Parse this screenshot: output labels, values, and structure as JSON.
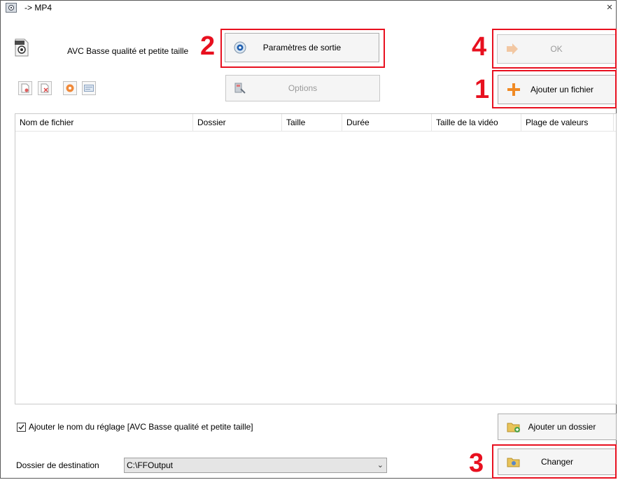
{
  "window": {
    "title": "-> MP4",
    "close_symbol": "×"
  },
  "preset": {
    "label": "AVC Basse qualité et petite taille"
  },
  "buttons": {
    "output_params": "Paramètres de sortie",
    "ok": "OK",
    "options": "Options",
    "add_file": "Ajouter un fichier",
    "add_folder": "Ajouter un dossier",
    "change": "Changer"
  },
  "annotations": {
    "n1": "1",
    "n2": "2",
    "n3": "3",
    "n4": "4",
    "color": "#e8101f"
  },
  "table": {
    "columns": [
      "Nom de fichier",
      "Dossier",
      "Taille",
      "Durée",
      "Taille de la vidéo",
      "Plage de valeurs"
    ]
  },
  "options": {
    "add_preset_name_label": "Ajouter le nom du réglage [AVC Basse qualité et petite taille]",
    "add_preset_name_checked": true
  },
  "destination": {
    "label": "Dossier de destination",
    "value": "C:\\FFOutput"
  }
}
